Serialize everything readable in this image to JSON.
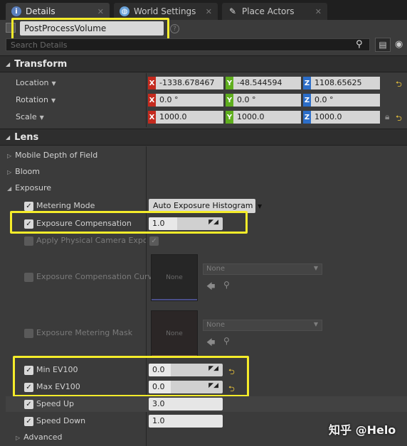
{
  "tabs": [
    {
      "label": "Details",
      "icon": "info-icon"
    },
    {
      "label": "World Settings",
      "icon": "globe-icon"
    },
    {
      "label": "Place Actors",
      "icon": "place-actors-icon"
    }
  ],
  "actor_name": "PostProcessVolume",
  "search": {
    "placeholder": "Search Details"
  },
  "transform": {
    "header": "Transform",
    "location": {
      "label": "Location",
      "x": "-1338.678467",
      "y": "-48.544594",
      "z": "1108.65625"
    },
    "rotation": {
      "label": "Rotation",
      "x": "0.0 °",
      "y": "0.0 °",
      "z": "0.0 °"
    },
    "scale": {
      "label": "Scale",
      "x": "1000.0",
      "y": "1000.0",
      "z": "1000.0"
    }
  },
  "axis_labels": {
    "x": "X",
    "y": "Y",
    "z": "Z"
  },
  "lens": {
    "header": "Lens",
    "mobile_dof": "Mobile Depth of Field",
    "bloom": "Bloom",
    "exposure": {
      "header": "Exposure",
      "metering_mode": {
        "label": "Metering Mode",
        "value": "Auto Exposure Histogram",
        "enabled": true
      },
      "exposure_compensation": {
        "label": "Exposure Compensation",
        "value": "1.0",
        "enabled": true,
        "fill": 0.38
      },
      "apply_physical_camera": {
        "label": "Apply Physical Camera Exposu",
        "enabled": false,
        "checked": true
      },
      "compensation_curve": {
        "label": "Exposure Compensation Curve",
        "thumb": "None",
        "asset": "None"
      },
      "metering_mask": {
        "label": "Exposure Metering Mask",
        "thumb": "None",
        "asset": "None"
      },
      "min_ev100": {
        "label": "Min EV100",
        "value": "0.0",
        "enabled": true,
        "fill": 0.3
      },
      "max_ev100": {
        "label": "Max EV100",
        "value": "0.0",
        "enabled": true,
        "fill": 0.3
      },
      "speed_up": {
        "label": "Speed Up",
        "value": "3.0",
        "enabled": true
      },
      "speed_down": {
        "label": "Speed Down",
        "value": "1.0",
        "enabled": true
      },
      "advanced": "Advanced"
    }
  },
  "watermark": "知乎 @Helo",
  "colors": {
    "highlight": "#f5ec2a",
    "x_axis": "#c42a1e",
    "y_axis": "#5fae1e",
    "z_axis": "#2c6ec9",
    "reset": "#e8c23a"
  }
}
